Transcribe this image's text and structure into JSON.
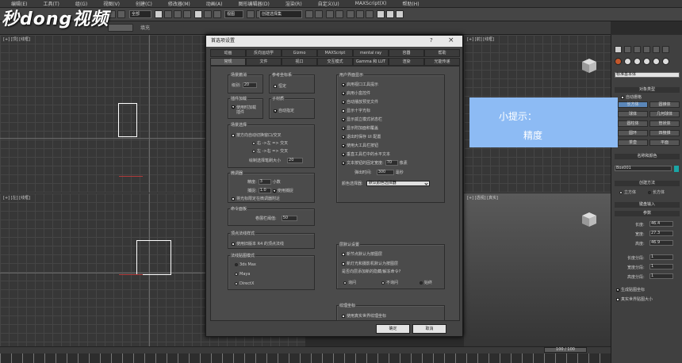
{
  "menubar": [
    "编辑(E)",
    "工具(T)",
    "组(G)",
    "视图(V)",
    "创建(C)",
    "修改器(M)",
    "动画(A)",
    "图形编辑器(D)",
    "渲染(R)",
    "自定义(U)",
    "MAXScript(X)",
    "帮助(H)"
  ],
  "toolbar": {
    "selection_filter": "全部",
    "view_select": "视图",
    "named_selection": "创建选择集"
  },
  "logo": "秒dong视频",
  "fill_label": "填充",
  "viewports": {
    "top_label": "[+] [顶] [线框]",
    "front_label": "[+] [前] [线框]",
    "left_label": "[+] [左] [线框]",
    "persp_label": "[+] [透视] [真实]"
  },
  "timeline": {
    "slider": "100 / 100"
  },
  "tip": {
    "title": "小提示：",
    "text": "精度"
  },
  "right_panel": {
    "dropdown": "标准基本体",
    "object_type_header": "对象类型",
    "autogrid": "自动栅格",
    "buttons": [
      "长方体",
      "圆锥体",
      "球体",
      "几何球体",
      "圆柱体",
      "管状体",
      "圆环",
      "四棱锥",
      "茶壶",
      "平面"
    ],
    "name_color_header": "名称和颜色",
    "object_name": "Box001",
    "creation_method_header": "创建方法",
    "cube_radio": "立方体",
    "box_radio": "长方体",
    "keyboard_header": "键盘输入",
    "params_header": "参数",
    "length_label": "长度:",
    "length_value": "46.4",
    "width_label": "宽度:",
    "width_value": "27.3",
    "height_label": "高度:",
    "height_value": "46.9",
    "length_segs_label": "长度分段:",
    "length_segs": "1",
    "width_segs_label": "宽度分段:",
    "width_segs": "1",
    "height_segs_label": "高度分段:",
    "height_segs": "1",
    "gen_map": "生成贴图坐标",
    "real_world": "真实世界贴图大小"
  },
  "dialog": {
    "title": "首选项设置",
    "help": "?",
    "close": "×",
    "tabs_row1": [
      "动画",
      "反向运动学",
      "Gizmo",
      "MAXScript",
      "mental ray",
      "容器",
      "帮助"
    ],
    "tabs_row2": [
      "常规",
      "文件",
      "视口",
      "交互模式",
      "Gamma 和 LUT",
      "渲染",
      "光能传递"
    ],
    "scene_undo": {
      "title": "场景撤消",
      "levels_label": "级别:",
      "levels": "20"
    },
    "ref_coord": {
      "title": "参考坐标系",
      "constant": "恒定"
    },
    "plugin": {
      "title": "插件加载",
      "line1": "使用时加载",
      "line2": "插件"
    },
    "subobj": {
      "title": "子材质",
      "auto": "自动指定"
    },
    "scene_sel": {
      "title": "场景选择",
      "auto_window": "按方向自动切换窗口/交叉",
      "rl": "右 ->左 => 交叉",
      "lr": "左 ->右 => 交叉",
      "paint_label": "绘制选择笔刷大小",
      "paint": "20"
    },
    "spinner": {
      "title": "微调器",
      "precision_label": "精度:",
      "precision": "3",
      "decimals": "小数",
      "snap_label": "捕捉:",
      "snap": "1.0",
      "use_snap": "使用捕捉",
      "wrap": "将光标限定在微调器附近"
    },
    "cmd_panel": {
      "title": "命令面板",
      "width_label": "卷展栏阈值:",
      "width": "50"
    },
    "vertex": {
      "title": "顶点法线样式",
      "legacy": "使用旧版本 R4 的顶点法线"
    },
    "ui_mode": {
      "title": "法线贴图模式",
      "max": "3ds Max",
      "maya": "Maya",
      "directx": "DirectX"
    },
    "ui_display": {
      "title": "用户界面显示",
      "items": [
        "启用视口工具提示",
        "启用小盒控件",
        "自动播放预览文件",
        "显示十字光标",
        "显示孤立模式状态栏",
        "显示附加面积覆盖",
        "退出时保存 UI 配置",
        "使用大工具栏按钮",
        "垂直工具栏中的水平文本",
        "文本按钮的固定宽度:"
      ],
      "btn_width": "70",
      "pixels": "像素",
      "flyout_label": "弹出时间:",
      "flyout": "300",
      "ms": "毫秒",
      "color_picker_label": "颜色选择器:",
      "color_picker": "默认颜色选择器"
    },
    "layer": {
      "title": "层默认设置",
      "new_lights": "新节点默认为按图层",
      "add_default": "新灯光和摄影机默认为按图层",
      "ask": "是否向层添加新的隐藏/解冻命令?",
      "auto": "询问",
      "no": "不询问",
      "always": "始终"
    },
    "texture": {
      "title": "纹理坐标",
      "real": "使用真实世界纹理坐标"
    },
    "ok": "确定",
    "cancel": "取消"
  }
}
